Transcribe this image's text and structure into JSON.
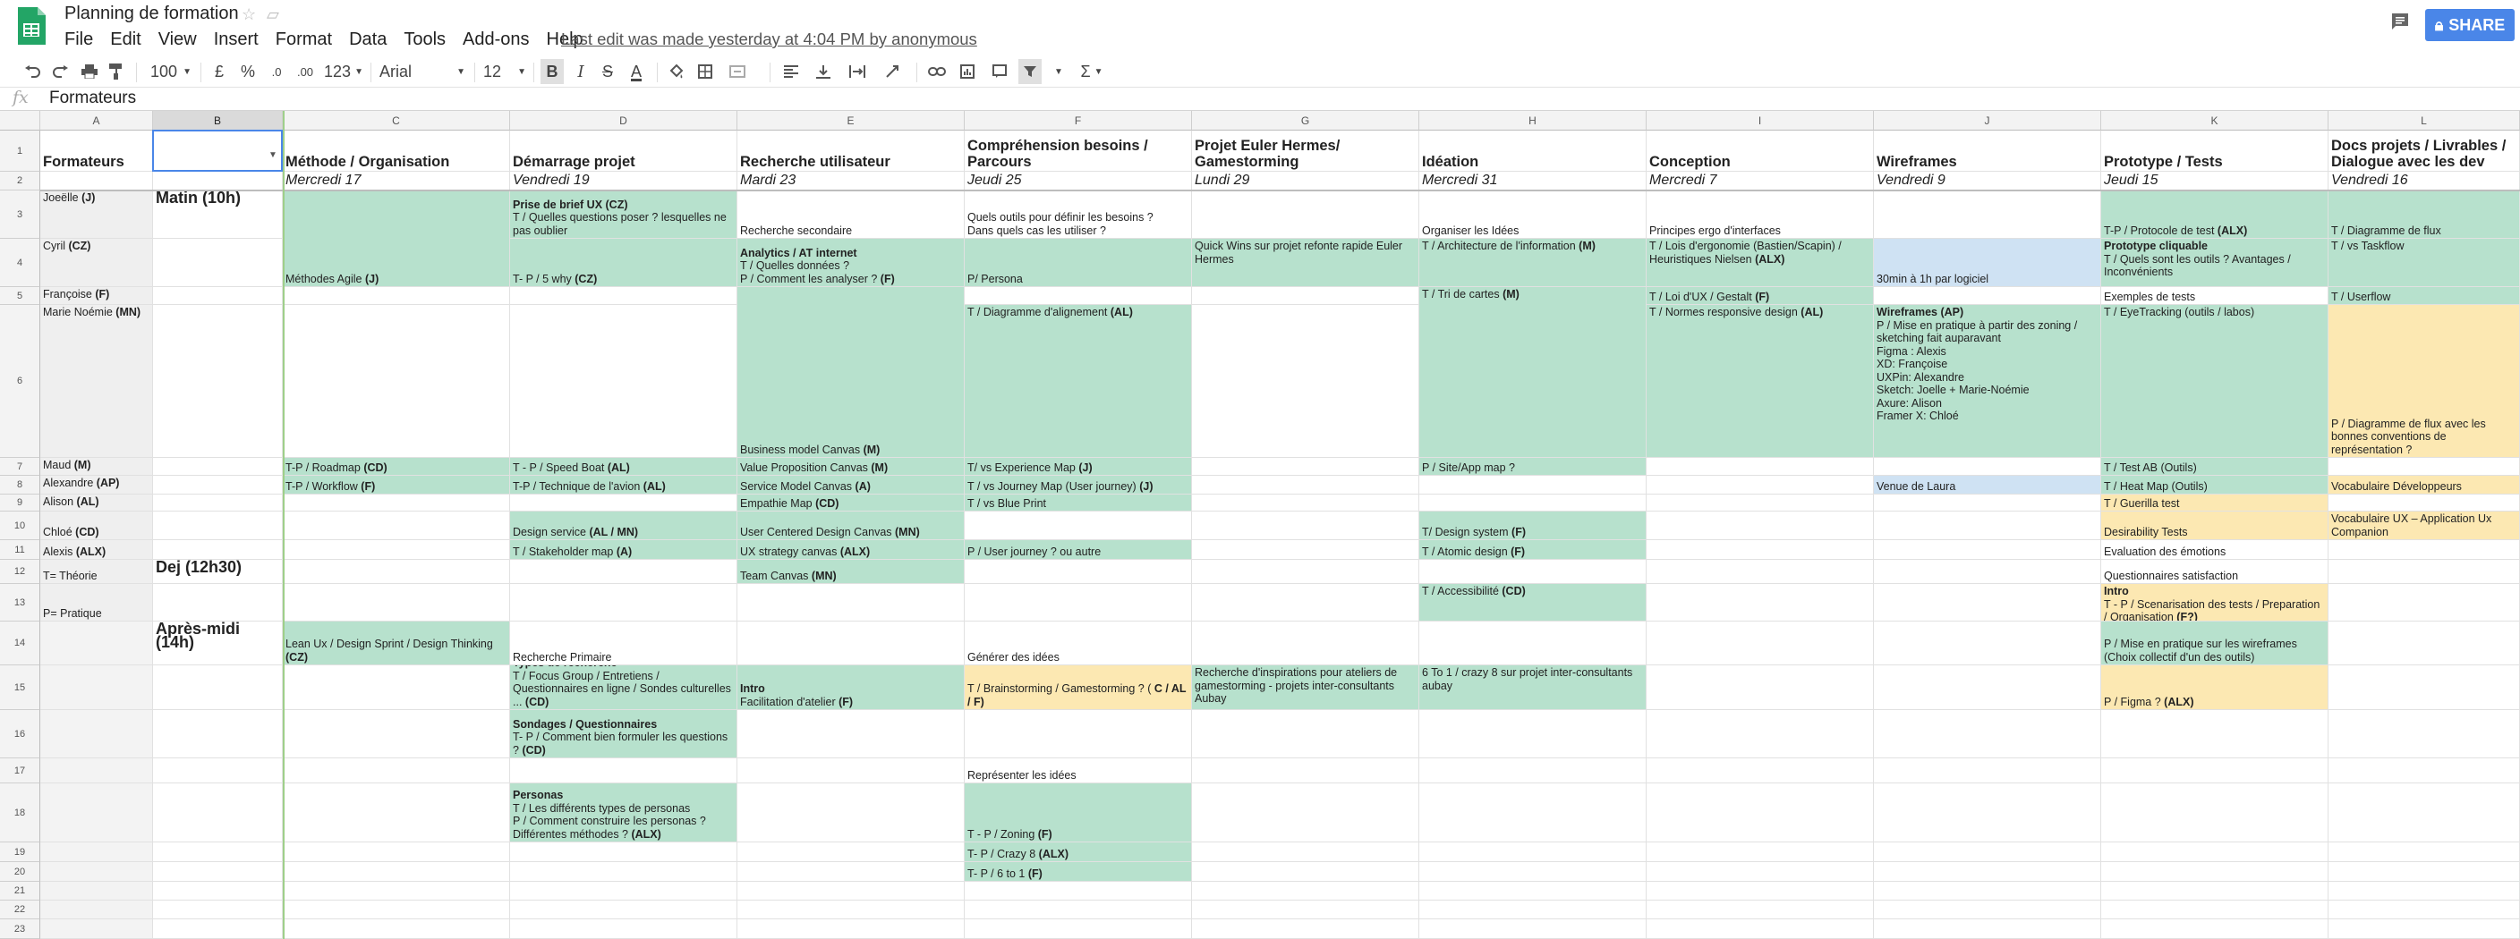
{
  "app": {
    "title": "Planning de formation",
    "menu": [
      "File",
      "Edit",
      "View",
      "Insert",
      "Format",
      "Data",
      "Tools",
      "Add-ons",
      "Help"
    ],
    "last_edit": "Last edit was made yesterday at 4:04 PM by anonymous",
    "share": "SHARE"
  },
  "toolbar": {
    "zoom": "100",
    "currency": "£",
    "percent": "%",
    "dec_less": ".0",
    "dec_more": ".00",
    "more_formats": "123",
    "font": "Arial",
    "font_size": "12",
    "bold": "B",
    "italic": "I",
    "strike": "S",
    "text_color": "A",
    "sigma": "Σ"
  },
  "formula": {
    "fx": "fx",
    "value": "Formateurs"
  },
  "columns": [
    "A",
    "B",
    "C",
    "D",
    "E",
    "F",
    "G",
    "H",
    "I",
    "J",
    "K",
    "L"
  ],
  "rows": [
    "1",
    "2",
    "3",
    "4",
    "5",
    "6",
    "7",
    "8",
    "9",
    "10",
    "11",
    "12",
    "13",
    "14",
    "15",
    "16",
    "17",
    "18",
    "19",
    "20",
    "21",
    "22",
    "23"
  ],
  "header": {
    "a1": "Formateurs",
    "c1": "Méthode / Organisation",
    "d1": "Démarrage projet",
    "e1": "Recherche utilisateur",
    "f1": "Compréhension besoins / Parcours",
    "g1": "Projet Euler Hermes/ Gamestorming",
    "h1": "Idéation",
    "i1": "Conception",
    "j1": "Wireframes",
    "k1": "Prototype / Tests",
    "l1": "Docs projets / Livrables / Dialogue avec les dev"
  },
  "dates": {
    "c2": "Mercredi 17",
    "d2": "Vendredi 19",
    "e2": "Mardi 23",
    "f2": "Jeudi 25",
    "g2": "Lundi 29",
    "h2": "Mercredi 31",
    "i2": "Mercredi 7",
    "j2": "Vendredi 9",
    "k2": "Jeudi 15",
    "l2": "Vendredi 16"
  },
  "trainers": {
    "a3": "Joeëlle",
    "a3b": "(J)",
    "a4": "Cyril",
    "a4b": "(CZ)",
    "a5": "Françoise",
    "a5b": "(F)",
    "a6": "Marie Noémie",
    "a6b": "(MN)",
    "a7": "Maud",
    "a7b": "(M)",
    "a8": "Alexandre",
    "a8b": "(AP)",
    "a9": "Alison",
    "a9b": "(AL)",
    "a10": "Chloé",
    "a10b": "(CD)",
    "a11": "Alexis",
    "a11b": "(ALX)",
    "a12": "T= Théorie",
    "a13": "P= Pratique"
  },
  "slots": {
    "b3": "Matin (10h)",
    "b12": "Dej (12h30)",
    "b14": "Après-midi (14h)"
  },
  "c": {
    "c3a": "Méthodes Agile ",
    "c3b": "(J)",
    "c7a": "T-P / Roadmap ",
    "c7b": "(CD)",
    "c8a": "T-P / Workflow ",
    "c8b": "(F)",
    "c14a": "Lean Ux / Design Sprint / Design Thinking ",
    "c14b": "(CZ)"
  },
  "d": {
    "d3a": "Prise de brief UX (CZ)",
    "d3b": "T / Quelles questions poser ? lesquelles ne pas oublier",
    "d4a": "T- P / 5 why ",
    "d4b": "(CZ)",
    "d7a": "T - P / Speed Boat ",
    "d7b": "(AL)",
    "d8a": "T-P / Technique de l'avion ",
    "d8b": "(AL)",
    "d10a": "Design service ",
    "d10b": "(AL / MN)",
    "d11a": "T / Stakeholder map ",
    "d11b": "(A)",
    "d14": "Recherche Primaire",
    "d15a": "Types de recherche",
    "d15b": "T / Focus Group / Entretiens / Questionnaires en ligne / Sondes culturelles ... ",
    "d15c": "(CD)",
    "d16a": "Sondages / Questionnaires",
    "d16b": "T- P / Comment bien formuler les questions ? ",
    "d16c": "(CD)",
    "d18a": "Personas",
    "d18b": "T / Les différents types de personas\nP / Comment construire les personas ?\nDifférentes méthodes ? ",
    "d18c": "(ALX)"
  },
  "e": {
    "e3": "Recherche secondaire",
    "e4a": "Analytics / AT internet",
    "e4b": "T / Quelles données ?\nP / Comment les analyser ? ",
    "e4c": "(F)",
    "e6a": "Business model Canvas ",
    "e6b": "(M)",
    "e7a": "Value Proposition Canvas ",
    "e7b": "(M)",
    "e8a": "Service Model Canvas ",
    "e8b": "(A)",
    "e9a": "Empathie Map ",
    "e9b": "(CD)",
    "e10a": "User Centered Design Canvas ",
    "e10b": "(MN)",
    "e11a": "UX strategy canvas ",
    "e11b": "(ALX)",
    "e12a": "Team Canvas ",
    "e12b": "(MN)",
    "e15a": "Intro",
    "e15b": "Facilitation d'atelier ",
    "e15c": "(F)"
  },
  "f": {
    "f3": "Quels outils pour définir les besoins ?\nDans quels cas les utiliser ?",
    "f4": "P/ Persona",
    "f6a": "T / Diagramme d'alignement ",
    "f6b": "(AL)",
    "f7a": "T/ vs Experience Map ",
    "f7b": "(J)",
    "f8a": "T / vs Journey Map (User journey) ",
    "f8b": "(J)",
    "f9": "T / vs Blue Print",
    "f11": "P / User journey ? ou autre",
    "f14": "Générer des idées",
    "f15a": "T / Brainstorming / Gamestorming ? ( ",
    "f15b": "C / AL / F)",
    "f17": "Représenter les idées",
    "f18a": "T - P / Zoning ",
    "f18b": "(F)",
    "f19a": "T- P / Crazy 8 ",
    "f19b": "(ALX)",
    "f20a": "T- P / 6 to 1 ",
    "f20b": "(F)"
  },
  "g": {
    "g4": "Quick Wins sur projet refonte rapide Euler Hermes",
    "g15": "Recherche d'inspirations pour ateliers de gamestorming - projets inter-consultants Aubay"
  },
  "h": {
    "h3": "Organiser les Idées",
    "h4a": "T / Architecture de l'information ",
    "h4b": "(M)",
    "h5a": "T / Tri de cartes ",
    "h5b": "(M)",
    "h7": "P / Site/App map ?",
    "h10a": "T/ Design system ",
    "h10b": "(F)",
    "h11a": "T / Atomic design ",
    "h11b": "(F)",
    "h13a": "T / Accessibilité ",
    "h13b": "(CD)",
    "h15": "6 To 1 / crazy 8 sur projet inter-consultants aubay"
  },
  "i": {
    "i3": "Principes ergo d'interfaces",
    "i4a": "T / Lois d'ergonomie (Bastien/Scapin) / Heuristiques Nielsen ",
    "i4b": "(ALX)",
    "i5a": "T / Loi d'UX / Gestalt ",
    "i5b": "(F)",
    "i6a": "T / Normes responsive design ",
    "i6b": "(AL)"
  },
  "j": {
    "j4": "30min à 1h par logiciel",
    "j6a": "Wireframes (AP)",
    "j6b": "P / Mise en pratique à partir des zoning / sketching fait auparavant\nFigma : Alexis\nXD: Françoise\nUXPin: Alexandre\nSketch: Joelle + Marie-Noémie\nAxure: Alison\nFramer X: Chloé",
    "j8": "Venue de Laura"
  },
  "k": {
    "k3a": "T-P / Protocole de test ",
    "k3b": "(ALX)",
    "k4a": "Prototype cliquable",
    "k4b": "T / Quels sont les outils ? Avantages / Inconvénients",
    "k5": "Exemples de tests",
    "k6": "T / EyeTracking (outils / labos)",
    "k7": "T / Test AB (Outils)",
    "k8": "T / Heat Map (Outils)",
    "k9": "T / Guerilla test",
    "k10": "Desirability Tests",
    "k11": "Evaluation des émotions",
    "k12": "Questionnaires satisfaction",
    "k13a": "Intro",
    "k13b": "T - P / Scenarisation des tests / Preparation / Organisation ",
    "k13c": "(F?)",
    "k14": "P / Mise en pratique sur les wireframes (Choix collectif d'un des outils)",
    "k15a": "P / Figma ? ",
    "k15b": "(ALX)"
  },
  "l": {
    "l3": "T / Diagramme de flux",
    "l4": "T / vs Taskflow",
    "l5": "T / Userflow",
    "l6": "P / Diagramme de flux avec les bonnes conventions de représentation ?",
    "l8": "Vocabulaire Développeurs",
    "l10": "Vocabulaire UX – Application Ux Companion"
  }
}
